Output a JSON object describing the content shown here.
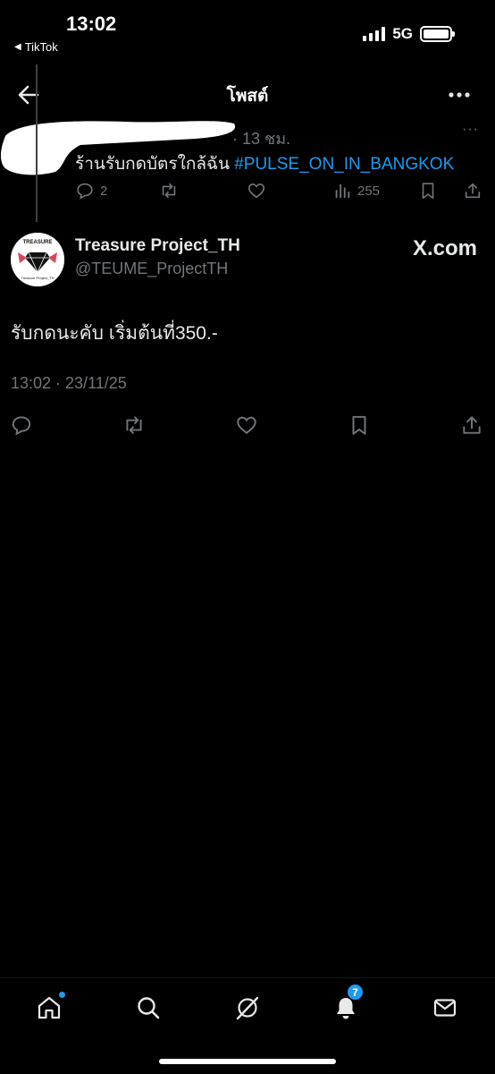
{
  "status_bar": {
    "time": "13:02",
    "back_app": "TikTok",
    "network": "5G"
  },
  "header": {
    "title": "โพสต์",
    "back_icon": "arrow-left-icon",
    "more_icon": "more-horizontal-icon"
  },
  "previous_post": {
    "time": "· 13 ชม.",
    "more": "···",
    "text": "ร้านรับกดบัตรใกล้ฉัน",
    "hashtag": "#PULSE_ON_IN_BANGKOK",
    "replies": "2",
    "views": "255"
  },
  "post": {
    "author_name": "Treasure Project_TH",
    "author_handle": "@TEUME_ProjectTH",
    "watermark": "X.com",
    "avatar_text": "TREASURE",
    "avatar_caption": "Treasure Project_TH",
    "text": "รับกดนะคับ เริ่มต้นที่350.-",
    "timestamp": "13:02 · 23/11/25"
  },
  "bottom_nav": {
    "notifications_badge": "7"
  },
  "colors": {
    "background": "#000000",
    "text": "#e7e9ea",
    "muted": "#71767b",
    "accent": "#1d9bf0"
  }
}
